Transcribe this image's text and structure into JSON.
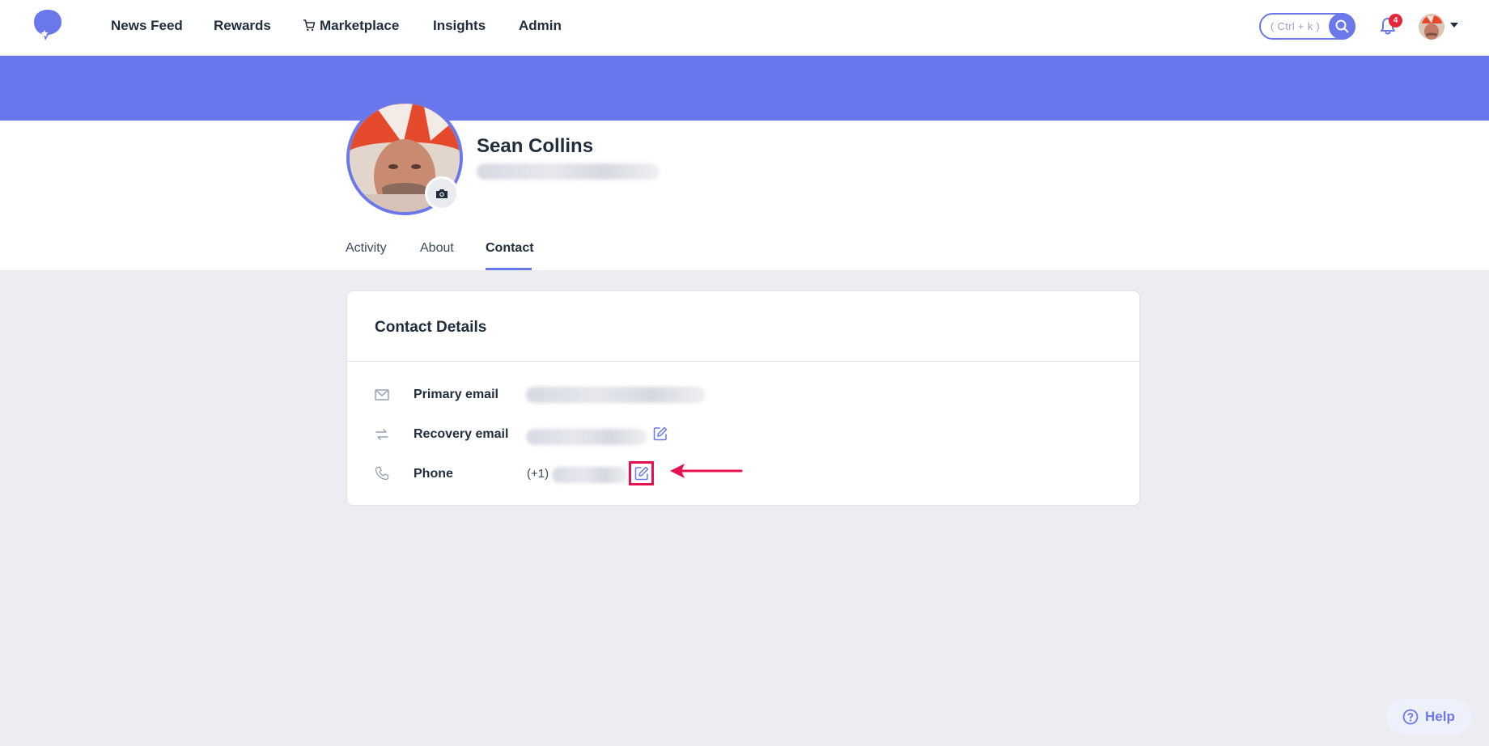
{
  "nav": {
    "items": [
      {
        "label": "News Feed"
      },
      {
        "label": "Rewards"
      },
      {
        "label": "Marketplace"
      },
      {
        "label": "Insights"
      },
      {
        "label": "Admin"
      }
    ],
    "search_hint": "( Ctrl + k )",
    "notification_count": "4"
  },
  "profile": {
    "name": "Sean Collins"
  },
  "tabs": [
    {
      "label": "Activity"
    },
    {
      "label": "About"
    },
    {
      "label": "Contact"
    }
  ],
  "contact": {
    "title": "Contact Details",
    "rows": [
      {
        "label": "Primary email"
      },
      {
        "label": "Recovery email"
      },
      {
        "label": "Phone",
        "prefix": "(+1)"
      }
    ]
  },
  "help": {
    "label": "Help"
  },
  "colors": {
    "accent": "#6a78ea",
    "banner": "#6878ec",
    "highlight": "#e5124f",
    "badge": "#e6243a"
  }
}
